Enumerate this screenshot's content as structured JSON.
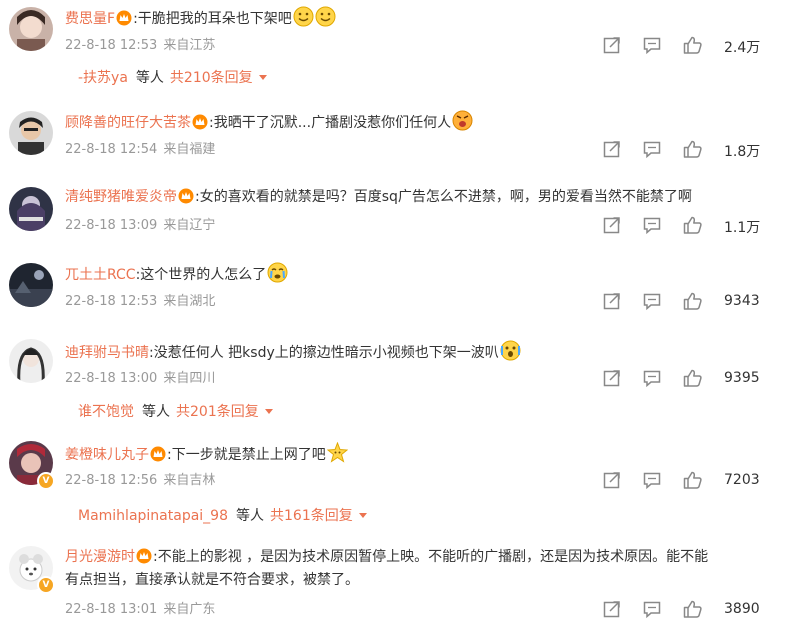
{
  "comments": [
    {
      "username": "费思量F",
      "text": ":干脆把我的耳朵也下架吧",
      "emojis": [
        "smile-emoji",
        "smile-emoji"
      ],
      "time": "22-8-18 12:53",
      "location": "来自江苏",
      "likes": "2.4万",
      "replies": {
        "name": "-扶苏ya",
        "mid": "等人",
        "count": "共210条回复"
      }
    },
    {
      "username": "顾降善的旺仔大苦茶",
      "text": ":我晒干了沉默...广播剧没惹你们任何人",
      "emojis": [
        "angry-emoji"
      ],
      "time": "22-8-18 12:54",
      "location": "来自福建",
      "likes": "1.8万"
    },
    {
      "username": "清纯野猪唯爱炎帝",
      "text": ":女的喜欢看的就禁是吗？百度sq广告怎么不进禁，啊，男的爱看当然不能禁了啊",
      "emojis": [],
      "time": "22-8-18 13:09",
      "location": "来自辽宁",
      "likes": "1.1万"
    },
    {
      "username": "兀土土RCC",
      "text": ":这个世界的人怎么了",
      "emojis": [
        "cry-emoji"
      ],
      "time": "22-8-18 12:53",
      "location": "来自湖北",
      "likes": "9343"
    },
    {
      "username": "迪拜驸马书晴",
      "text": ":没惹任何人 把ksdy上的擦边性暗示小视频也下架一波叭",
      "emojis": [
        "shock-emoji"
      ],
      "time": "22-8-18 13:00",
      "location": "来自四川",
      "likes": "9395",
      "replies": {
        "name": "谁不饱觉",
        "mid": "等人",
        "count": "共201条回复"
      }
    },
    {
      "username": "姜橙味儿丸子",
      "text": ":下一步就是禁止上网了吧",
      "emojis": [
        "star-emoji"
      ],
      "time": "22-8-18 12:56",
      "location": "来自吉林",
      "likes": "7203",
      "replies": {
        "name": "Mamihlapinatapai_98",
        "mid": "等人",
        "count": "共161条回复"
      }
    },
    {
      "username": "月光漫游时",
      "text": ":不能上的影视 ，是因为技术原因暂停上映。不能听的广播剧，还是因为技术原因。能不能",
      "text2": "有点担当，直接承认就是不符合要求，被禁了。",
      "emojis": [],
      "time": "22-8-18 13:01",
      "location": "来自广东",
      "likes": "3890"
    }
  ],
  "colors": {
    "username": "#eb7350",
    "meta": "#999999",
    "text": "#333333",
    "icon": "#888888"
  },
  "icons": {
    "share": "share-icon",
    "comment": "comment-icon",
    "like": "thumbs-up-icon",
    "badge": "fan-crown-icon"
  }
}
